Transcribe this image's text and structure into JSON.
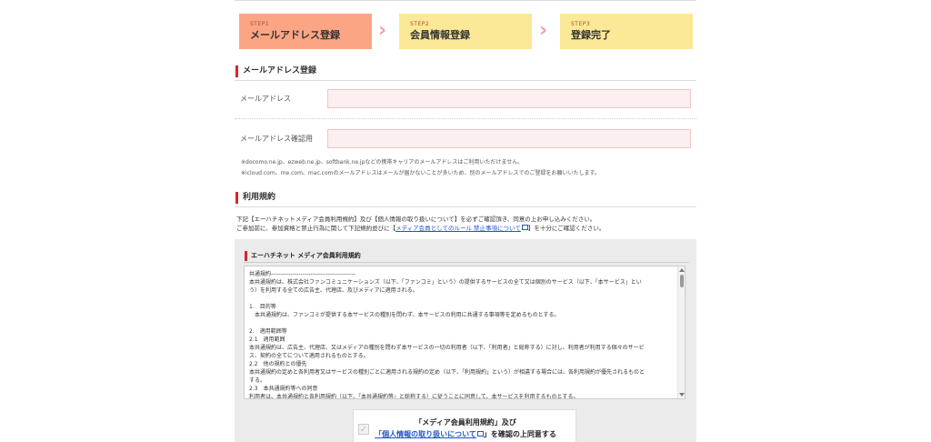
{
  "steps": [
    {
      "num": "STEP1",
      "label": "メールアドレス登録"
    },
    {
      "num": "STEP2",
      "label": "会員情報登録"
    },
    {
      "num": "STEP3",
      "label": "登録完了"
    }
  ],
  "chevron": "›",
  "email_section": {
    "title": "メールアドレス登録",
    "email_label": "メールアドレス",
    "confirm_label": "メールアドレス確認用",
    "note1": "※docomo.ne.jp、ezweb.ne.jp、softbank.ne.jpなどの携帯キャリアのメールアドレスはご利用いただけません。",
    "note2": "※icloud.com、me.com、mac.comのメールアドレスはメールが届かないことが多いため、別のメールアドレスでのご登録をお願いいたします。"
  },
  "terms_section": {
    "title": "利用規約",
    "intro_line1": "下記【エーハチネットメディア会員利用規約】及び【個人情報の取り扱いについて】を必ずご確認頂き、同意の上お申し込みください。",
    "intro_line2_pre": "ご参加前に、参加資格と禁止行為に関して下記規約並びに【",
    "intro_line2_link": "メディア会員としてのルール 禁止事項について",
    "intro_line2_post": "】を十分にご確認ください。",
    "panel_title": "エーハチネット メディア会員利用規約",
    "terms_lines": [
      "共通規約-------------------------------------------",
      "本共通規約は、株式会社ファンコミュニケーションズ（以下、「ファンコミ」という）の提供するサービスの全て又は個別のサービス（以下、「本サービス」とい",
      "う）を利用する全ての広告主、代理店、及びメディアに適用される。",
      "",
      "1.　目的等",
      "　本共通規約は、ファンコミが提供する本サービスの種別を問わず、本サービスの利用に共通する事項等を定めるものとする。",
      "",
      "2.　適用範囲等",
      "2.1　適用範囲",
      "本共通規約は、広告主、代理店、又はメディアの種別を問わず本サービスの一切の利用者（以下、「利用者」と総称する）に対し、利用者が利用する個々のサービ",
      "ス、契約の全てについて適用されるものとする。",
      "2.2　他の規約との優先",
      "本共通規約の定めと各利用者又はサービスの種別ごとに適用される規約の定め（以下、「利用規約」という）が相違する場合には、各利用規約が優先されるものと",
      "する。",
      "2.3　本共通規約等への同意",
      "利用者は、本共通規約と各利用規約（以下、「本共通規約等」と総称する）に従うことに同意して、本サービスを利用するものとする。"
    ],
    "agree_line1": "「メディア会員利用規約」及び",
    "agree_link": "「個人情報の取り扱いについて",
    "agree_post": "」を確認の上同意する",
    "agree_check": "✓"
  }
}
